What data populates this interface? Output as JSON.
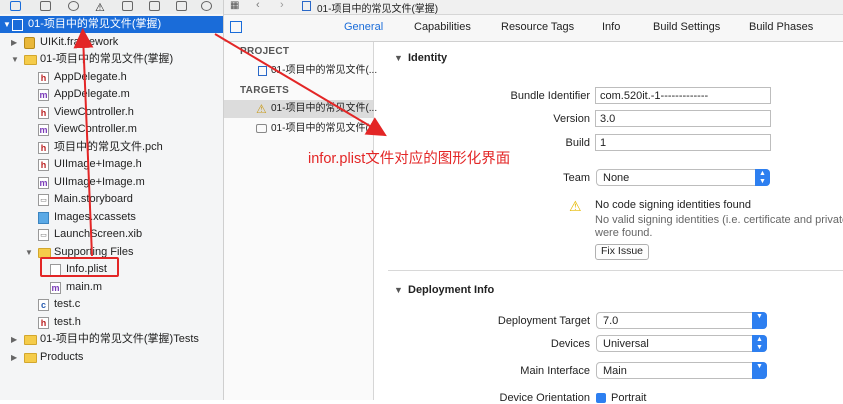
{
  "navigator": {
    "rows": [
      {
        "label": "01-项目中的常见文件(掌握)",
        "type": "proj",
        "disc": "▼"
      },
      {
        "label": "UIKit.framework",
        "type": "fw",
        "disc": "▶"
      },
      {
        "label": "01-项目中的常见文件(掌握)",
        "type": "folder",
        "disc": "▼"
      },
      {
        "label": "AppDelegate.h",
        "type": "h",
        "disc": ""
      },
      {
        "label": "AppDelegate.m",
        "type": "m",
        "disc": ""
      },
      {
        "label": "ViewController.h",
        "type": "h",
        "disc": ""
      },
      {
        "label": "ViewController.m",
        "type": "m",
        "disc": ""
      },
      {
        "label": "项目中的常见文件.pch",
        "type": "h",
        "disc": ""
      },
      {
        "label": "UIImage+Image.h",
        "type": "h",
        "disc": ""
      },
      {
        "label": "UIImage+Image.m",
        "type": "m",
        "disc": ""
      },
      {
        "label": "Main.storyboard",
        "type": "sb",
        "disc": ""
      },
      {
        "label": "Images.xcassets",
        "type": "xc",
        "disc": ""
      },
      {
        "label": "LaunchScreen.xib",
        "type": "sb",
        "disc": ""
      },
      {
        "label": "Supporting Files",
        "type": "folder",
        "disc": "▼"
      },
      {
        "label": "Info.plist",
        "type": "file",
        "disc": ""
      },
      {
        "label": "main.m",
        "type": "m",
        "disc": ""
      },
      {
        "label": "test.c",
        "type": "c",
        "disc": ""
      },
      {
        "label": "test.h",
        "type": "h",
        "disc": ""
      },
      {
        "label": "01-项目中的常见文件(掌握)Tests",
        "type": "folder",
        "disc": "▶"
      },
      {
        "label": "Products",
        "type": "folder",
        "disc": "▶"
      }
    ]
  },
  "editor": {
    "jump_bar": "01-项目中的常见文件(掌握)",
    "tabs": [
      "General",
      "Capabilities",
      "Resource Tags",
      "Info",
      "Build Settings",
      "Build Phases"
    ]
  },
  "targets_panel": {
    "project_header": "PROJECT",
    "project_item": "01-项目中的常见文件(...",
    "targets_header": "TARGETS",
    "target_items": [
      "01-项目中的常见文件(...",
      "01-项目中的常见文件(..."
    ]
  },
  "identity": {
    "title": "Identity",
    "bundle_identifier_label": "Bundle Identifier",
    "bundle_identifier": "com.520it.-1-------------",
    "version_label": "Version",
    "version": "3.0",
    "build_label": "Build",
    "build": "1",
    "team_label": "Team",
    "team": "None",
    "warning_title": "No code signing identities found",
    "warning_body": "No valid signing identities (i.e. certificate and private k",
    "warning_body2": "were found.",
    "fix_button": "Fix Issue"
  },
  "deployment": {
    "title": "Deployment Info",
    "target_label": "Deployment Target",
    "target": "7.0",
    "devices_label": "Devices",
    "devices": "Universal",
    "main_interface_label": "Main Interface",
    "main_interface": "Main",
    "orientation_label": "Device Orientation",
    "orientation": "Portrait"
  },
  "annotation": "infor.plist文件对应的图形化界面",
  "colors": {
    "selection": "#1a6cd9",
    "annotation": "#e32626",
    "accent": "#2d7ff0"
  }
}
